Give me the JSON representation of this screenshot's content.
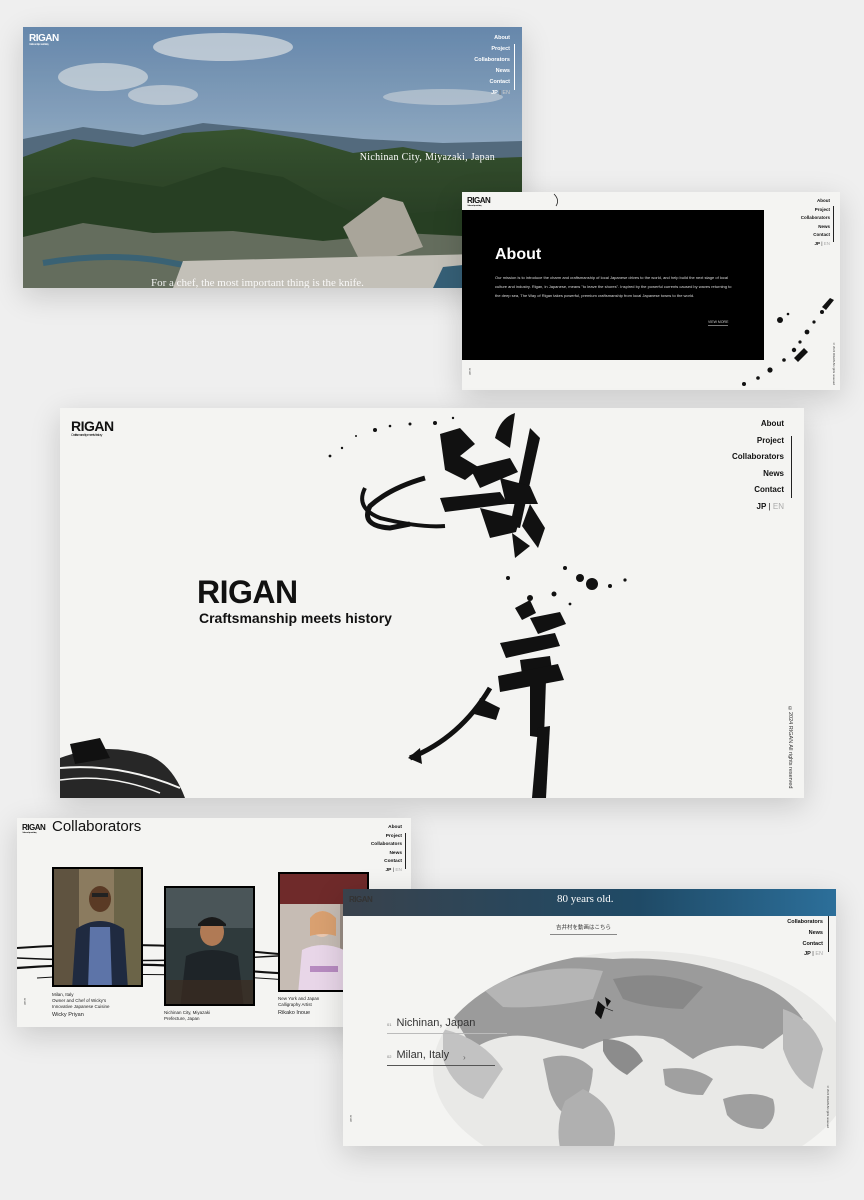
{
  "brand": {
    "name": "RIGAN",
    "tagline": "Craftsmanship meets history"
  },
  "nav": {
    "items": [
      "About",
      "Project",
      "Collaborators",
      "News",
      "Contact"
    ],
    "lang_active": "JP",
    "lang_sep": "|",
    "lang_other": "EN"
  },
  "aerial": {
    "location": "Nichinan City, Miyazaki, Japan",
    "quote": "For a chef, the most important thing is the knife."
  },
  "about": {
    "heading": "About",
    "body": "Our mission is to introduce the charm and craftsmanship of local Japanese drives to the world, and help build the next stage of local culture and industry. Rigan, in Japanese, means \"to leave the shores\". Inspired by the powerful currents caused by waves returning to the deep sea, The Way of Rigan takes powerful, premium craftsmanship from local Japanese towns to the world.",
    "link": "VIEW MORE"
  },
  "hero": {
    "title": "RIGAN",
    "subtitle": "Craftsmanship meets history",
    "copyright": "©2024 RIGAN All rights reserved"
  },
  "collaborators": {
    "heading": "Collaborators",
    "people": [
      {
        "place": "Milan, Italy",
        "role": "Owner and Chef of Wicky's Innovative Japanese Cuisine",
        "name": "Wicky Priyan"
      },
      {
        "place": "Nichinan City, Miyazaki Prefecture, Japan",
        "role": "",
        "name": ""
      },
      {
        "place": "New York and Japan",
        "role": "Calligraphy Artist",
        "name": "Rikako Inoue"
      }
    ]
  },
  "map": {
    "banner": "80 years old.",
    "button": "吉井村を動画はこちら",
    "locations": [
      {
        "num": "01",
        "label": "Nichinan, Japan"
      },
      {
        "num": "02",
        "label": "Milan, Italy"
      }
    ]
  }
}
